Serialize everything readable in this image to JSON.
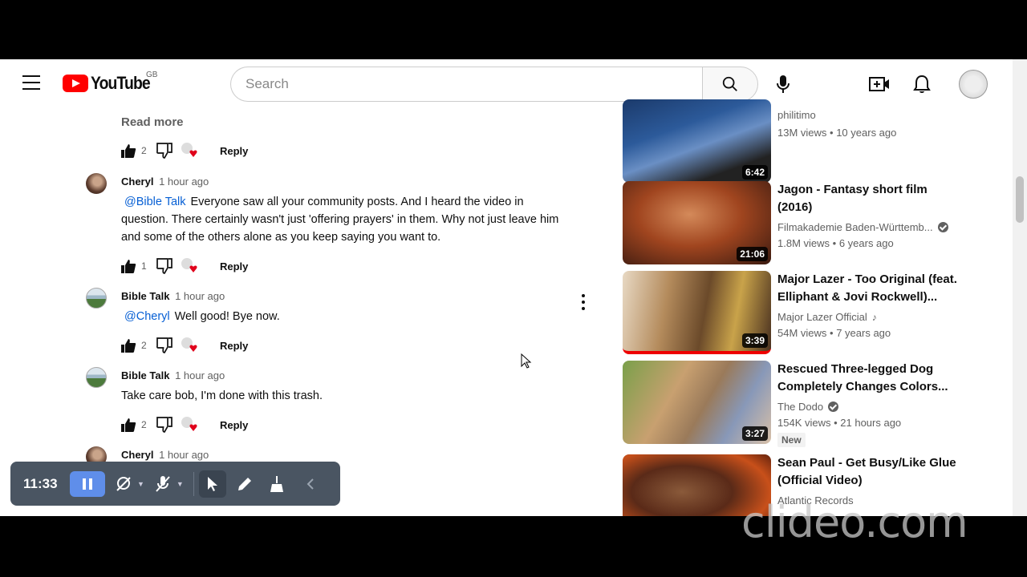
{
  "header": {
    "logo_text": "YouTube",
    "country_code": "GB",
    "search_placeholder": "Search"
  },
  "comments": {
    "read_more": "Read more",
    "reply_label": "Reply",
    "top_actions": {
      "likes": "2"
    },
    "items": [
      {
        "author": "Cheryl",
        "time": "1 hour ago",
        "mention": "@Bible Talk",
        "text": "Everyone saw all your community posts. And I heard the video in question. There certainly wasn't just 'offering prayers' in them. Why not just leave him and some of the others alone as you keep saying you want to.",
        "likes": "1"
      },
      {
        "author": "Bible Talk",
        "time": "1 hour ago",
        "mention": "@Cheryl",
        "text": "Well good! Bye now.",
        "likes": "2"
      },
      {
        "author": "Bible Talk",
        "time": "1 hour ago",
        "mention": "",
        "text": "Take care bob, I'm done with this trash.",
        "likes": "2"
      },
      {
        "author": "Cheryl",
        "time": "1 hour ago",
        "mention": "",
        "text": "",
        "likes": ""
      }
    ]
  },
  "sidebar": {
    "videos": [
      {
        "title": "",
        "channel": "philitimo",
        "views": "13M views",
        "age": "10 years ago",
        "duration": "6:42",
        "verified": false
      },
      {
        "title": "Jagon - Fantasy short film (2016)",
        "channel": "Filmakademie Baden-Württemb...",
        "views": "1.8M views",
        "age": "6 years ago",
        "duration": "21:06",
        "verified": true
      },
      {
        "title": "Major Lazer - Too Original (feat. Elliphant & Jovi Rockwell)...",
        "channel": "Major Lazer Official",
        "views": "54M views",
        "age": "7 years ago",
        "duration": "3:39",
        "verified": false,
        "music": true
      },
      {
        "title": "Rescued Three-legged Dog Completely Changes Colors...",
        "channel": "The Dodo",
        "views": "154K views",
        "age": "21 hours ago",
        "duration": "3:27",
        "verified": true,
        "badge": "New"
      },
      {
        "title": "Sean Paul - Get Busy/Like Glue (Official Video)",
        "channel": "Atlantic Records",
        "views": "",
        "age": "",
        "duration": "",
        "verified": false
      }
    ]
  },
  "recorder": {
    "time": "11:33"
  },
  "watermark": "clideo.com"
}
